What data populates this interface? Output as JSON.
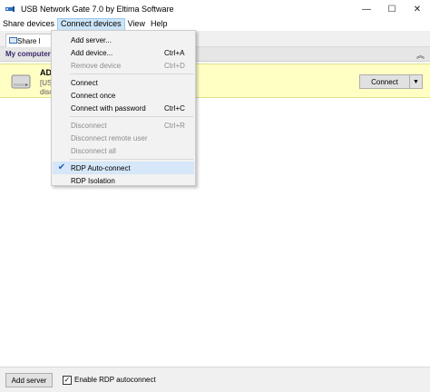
{
  "window": {
    "title": "USB Network Gate 7.0 by Eltima Software",
    "minimize": "—",
    "maximize": "☐",
    "close": "✕"
  },
  "menubar": {
    "items": [
      "Share devices",
      "Connect devices",
      "View",
      "Help"
    ]
  },
  "toolbar": {
    "share_tab": "Share l"
  },
  "section": {
    "title": "My computer",
    "collapse": "︽"
  },
  "device": {
    "name": "AD",
    "line1": "[US",
    "line2": "disc",
    "connect_label": "Connect",
    "dropdown_arrow": "▼"
  },
  "dropdown": {
    "items": [
      {
        "label": "Add server...",
        "shortcut": "",
        "disabled": false
      },
      {
        "label": "Add device...",
        "shortcut": "Ctrl+A",
        "disabled": false
      },
      {
        "label": "Remove device",
        "shortcut": "Ctrl+D",
        "disabled": true
      },
      {
        "label": "Connect",
        "shortcut": "",
        "disabled": false
      },
      {
        "label": "Connect once",
        "shortcut": "",
        "disabled": false
      },
      {
        "label": "Connect with password",
        "shortcut": "Ctrl+C",
        "disabled": false
      },
      {
        "label": "Disconnect",
        "shortcut": "Ctrl+R",
        "disabled": true
      },
      {
        "label": "Disconnect remote user",
        "shortcut": "",
        "disabled": true
      },
      {
        "label": "Disconnect all",
        "shortcut": "",
        "disabled": true
      },
      {
        "label": "RDP Auto-connect",
        "shortcut": "",
        "disabled": false,
        "checked": true
      },
      {
        "label": "RDP Isolation",
        "shortcut": "",
        "disabled": false
      }
    ],
    "check_mark": "✔"
  },
  "bottombar": {
    "add_server_label": "Add server",
    "rdp_label": "Enable RDP autoconnect",
    "rdp_checked_mark": "✓"
  },
  "colors": {
    "device_row_bg": "#ffffc4",
    "section_title": "#3a2a6b",
    "menu_active_bg": "#cce4f7",
    "check_color": "#1f5fbf"
  }
}
